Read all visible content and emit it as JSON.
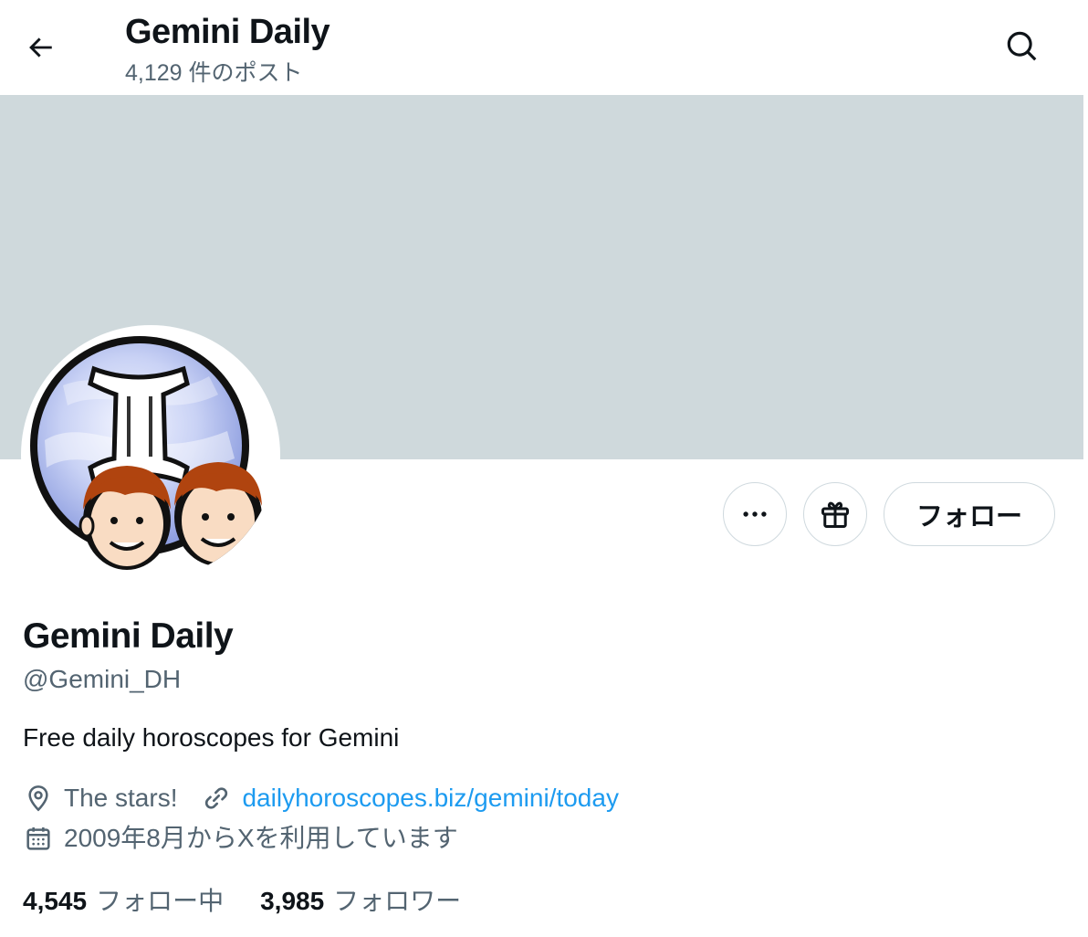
{
  "colors": {
    "banner": "#cfd9dc",
    "text_primary": "#0f1419",
    "text_secondary": "#536471",
    "link": "#1d9bf0",
    "border": "#cfd9de"
  },
  "header": {
    "back_icon": "arrow-left-icon",
    "title": "Gemini Daily",
    "post_count": "4,129 件のポスト",
    "search_icon": "search-icon"
  },
  "profile": {
    "avatar_icon": "gemini-twins-avatar",
    "display_name": "Gemini Daily",
    "handle": "@Gemini_DH",
    "bio": "Free daily horoscopes for Gemini",
    "location": "The stars!",
    "website": "dailyhoroscopes.biz/gemini/today",
    "joined": "2009年8月からXを利用しています"
  },
  "actions": {
    "more_icon": "more-dots-icon",
    "gift_icon": "gift-icon",
    "follow_label": "フォロー"
  },
  "stats": {
    "following_count": "4,545",
    "following_label": "フォロー中",
    "followers_count": "3,985",
    "followers_label": "フォロワー"
  }
}
